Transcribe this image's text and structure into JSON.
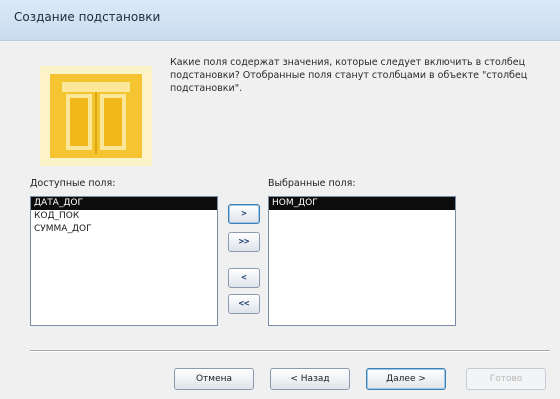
{
  "window": {
    "title": "Создание подстановки"
  },
  "instruction": "Какие поля содержат значения, которые следует включить в столбец подстановки? Отобранные поля станут столбцами в объекте \"столбец подстановки\".",
  "available": {
    "label": "Доступные поля:",
    "items": [
      "ДАТА_ДОГ",
      "КОД_ПОК",
      "СУММА_ДОГ"
    ],
    "selected_index": 0
  },
  "selected": {
    "label": "Выбранные поля:",
    "items": [
      "НОМ_ДОГ"
    ],
    "selected_index": 0
  },
  "move_buttons": {
    "add_one": ">",
    "add_all": ">>",
    "remove_one": "<",
    "remove_all": "<<"
  },
  "commands": {
    "cancel": "Отмена",
    "back": "< Назад",
    "next": "Далее >",
    "finish": "Готово"
  },
  "colors": {
    "art_yellow": "#f5c431",
    "art_light": "#fbe79a",
    "selection": "#0c0c0c"
  }
}
